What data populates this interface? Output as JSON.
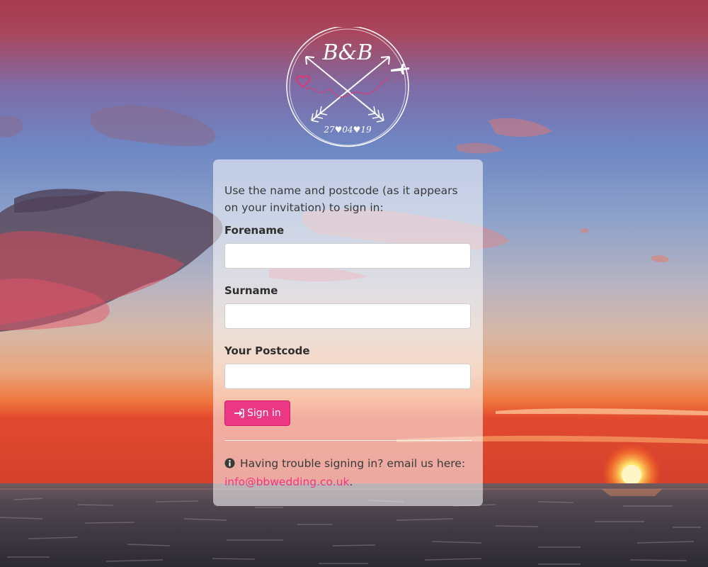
{
  "logo": {
    "initials": "B&B",
    "date": "27♥04♥19"
  },
  "login": {
    "intro": "Use the name and postcode (as it appears on your invitation) to sign in:",
    "forename_label": "Forename",
    "forename_value": "",
    "surname_label": "Surname",
    "surname_value": "",
    "postcode_label": "Your Postcode",
    "postcode_value": "",
    "signin_label": "Sign in",
    "signin_icon": "sign-in-icon"
  },
  "help": {
    "icon": "info-circle-icon",
    "text": "Having trouble signing in? email us here:",
    "email": "info@bbwedding.co.uk",
    "suffix": "."
  },
  "colors": {
    "accent": "#ec3785",
    "card_background": "rgba(255,255,255,0.55)"
  }
}
